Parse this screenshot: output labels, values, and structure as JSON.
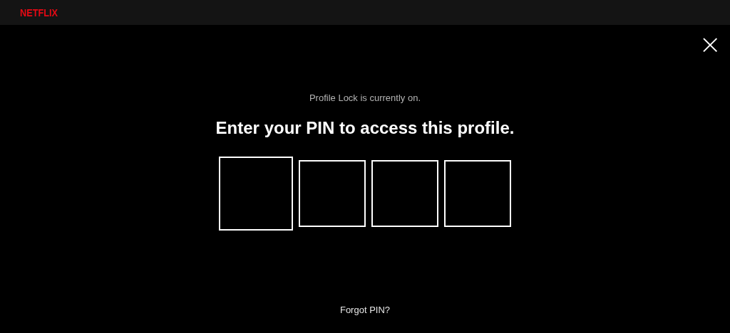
{
  "header": {
    "logo": "NETFLIX"
  },
  "close": {
    "label": "×"
  },
  "notice": "Profile Lock is currently on.",
  "title": "Enter your PIN to access this profile.",
  "pin_fields": [
    {
      "selected": true
    },
    {
      "selected": false
    },
    {
      "selected": false
    },
    {
      "selected": false
    }
  ],
  "forgot_link": "Forgot PIN?"
}
